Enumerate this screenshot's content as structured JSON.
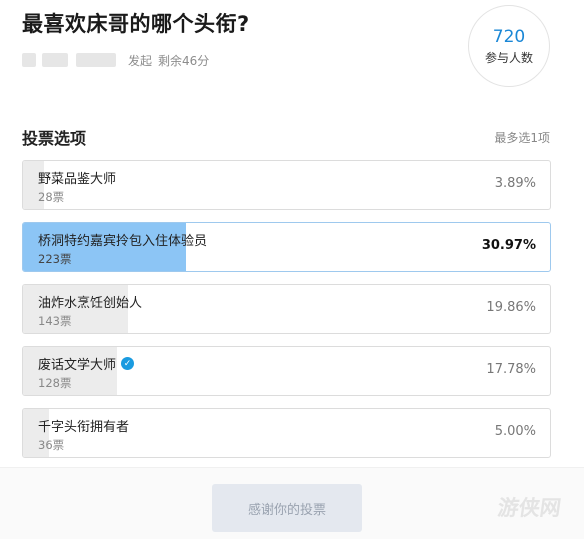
{
  "poll": {
    "title": "最喜欢床哥的哪个头衔?",
    "status": "发起",
    "remaining": "剩余46分"
  },
  "participants": {
    "count": "720",
    "label": "参与人数"
  },
  "section": {
    "title": "投票选项",
    "limit": "最多选1项"
  },
  "options": [
    {
      "label": "野菜品鉴大师",
      "votes": "28票",
      "percent": "3.89%",
      "share": 0.0389,
      "selected": false,
      "verified": false
    },
    {
      "label": "桥洞特约嘉宾拎包入住体验员",
      "votes": "223票",
      "percent": "30.97%",
      "share": 0.3097,
      "selected": true,
      "verified": false
    },
    {
      "label": "油炸水烹饪创始人",
      "votes": "143票",
      "percent": "19.86%",
      "share": 0.1986,
      "selected": false,
      "verified": false
    },
    {
      "label": "废话文学大师",
      "votes": "128票",
      "percent": "17.78%",
      "share": 0.1778,
      "selected": false,
      "verified": true
    },
    {
      "label": "千字头衔拥有者",
      "votes": "36票",
      "percent": "5.00%",
      "share": 0.05,
      "selected": false,
      "verified": false
    }
  ],
  "footer": {
    "button_label": "感谢你的投票",
    "watermark": "游侠网"
  },
  "colors": {
    "selected_fill": "#8cc5f5",
    "unselected_fill": "#ececec",
    "accent": "#1a87d6"
  },
  "icons": {
    "verified": "verified-check-icon"
  }
}
